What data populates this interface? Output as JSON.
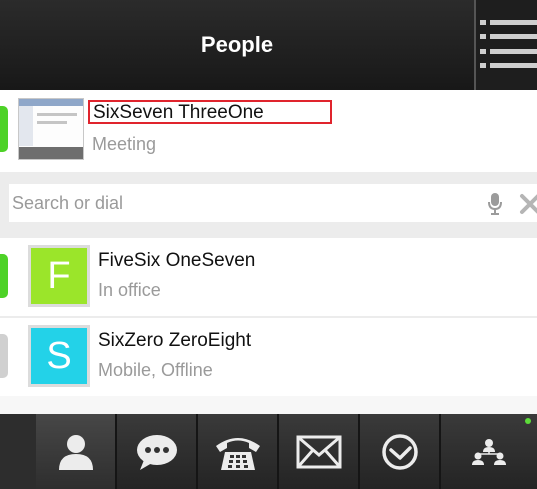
{
  "header": {
    "title": "People",
    "menu_icon": "hamburger-menu-icon"
  },
  "self_contact": {
    "name": "SixSeven ThreeOne",
    "status": "Meeting",
    "presence_color": "#4dd227",
    "thumbnail": "screen-share-thumbnail"
  },
  "search": {
    "placeholder": "Search or dial",
    "value": "",
    "mic_icon": "microphone-icon",
    "clear_icon": "clear-icon"
  },
  "contacts": [
    {
      "initial": "F",
      "name": "FiveSix OneSeven",
      "status": "In office",
      "avatar_color": "#9be52a",
      "presence_color": "#4dd227"
    },
    {
      "initial": "S",
      "name": "SixZero ZeroEight",
      "status": "Mobile, Offline",
      "avatar_color": "#23d2e8",
      "presence_color": "#d0d0d0"
    }
  ],
  "bottom_nav": [
    {
      "icon": "person-icon",
      "active": true
    },
    {
      "icon": "chat-bubble-icon",
      "active": false
    },
    {
      "icon": "phone-icon",
      "active": false
    },
    {
      "icon": "mail-icon",
      "active": false
    },
    {
      "icon": "clock-icon",
      "active": false
    },
    {
      "icon": "org-chart-icon",
      "active": false,
      "status_dot_color": "#5ddc3a"
    }
  ]
}
